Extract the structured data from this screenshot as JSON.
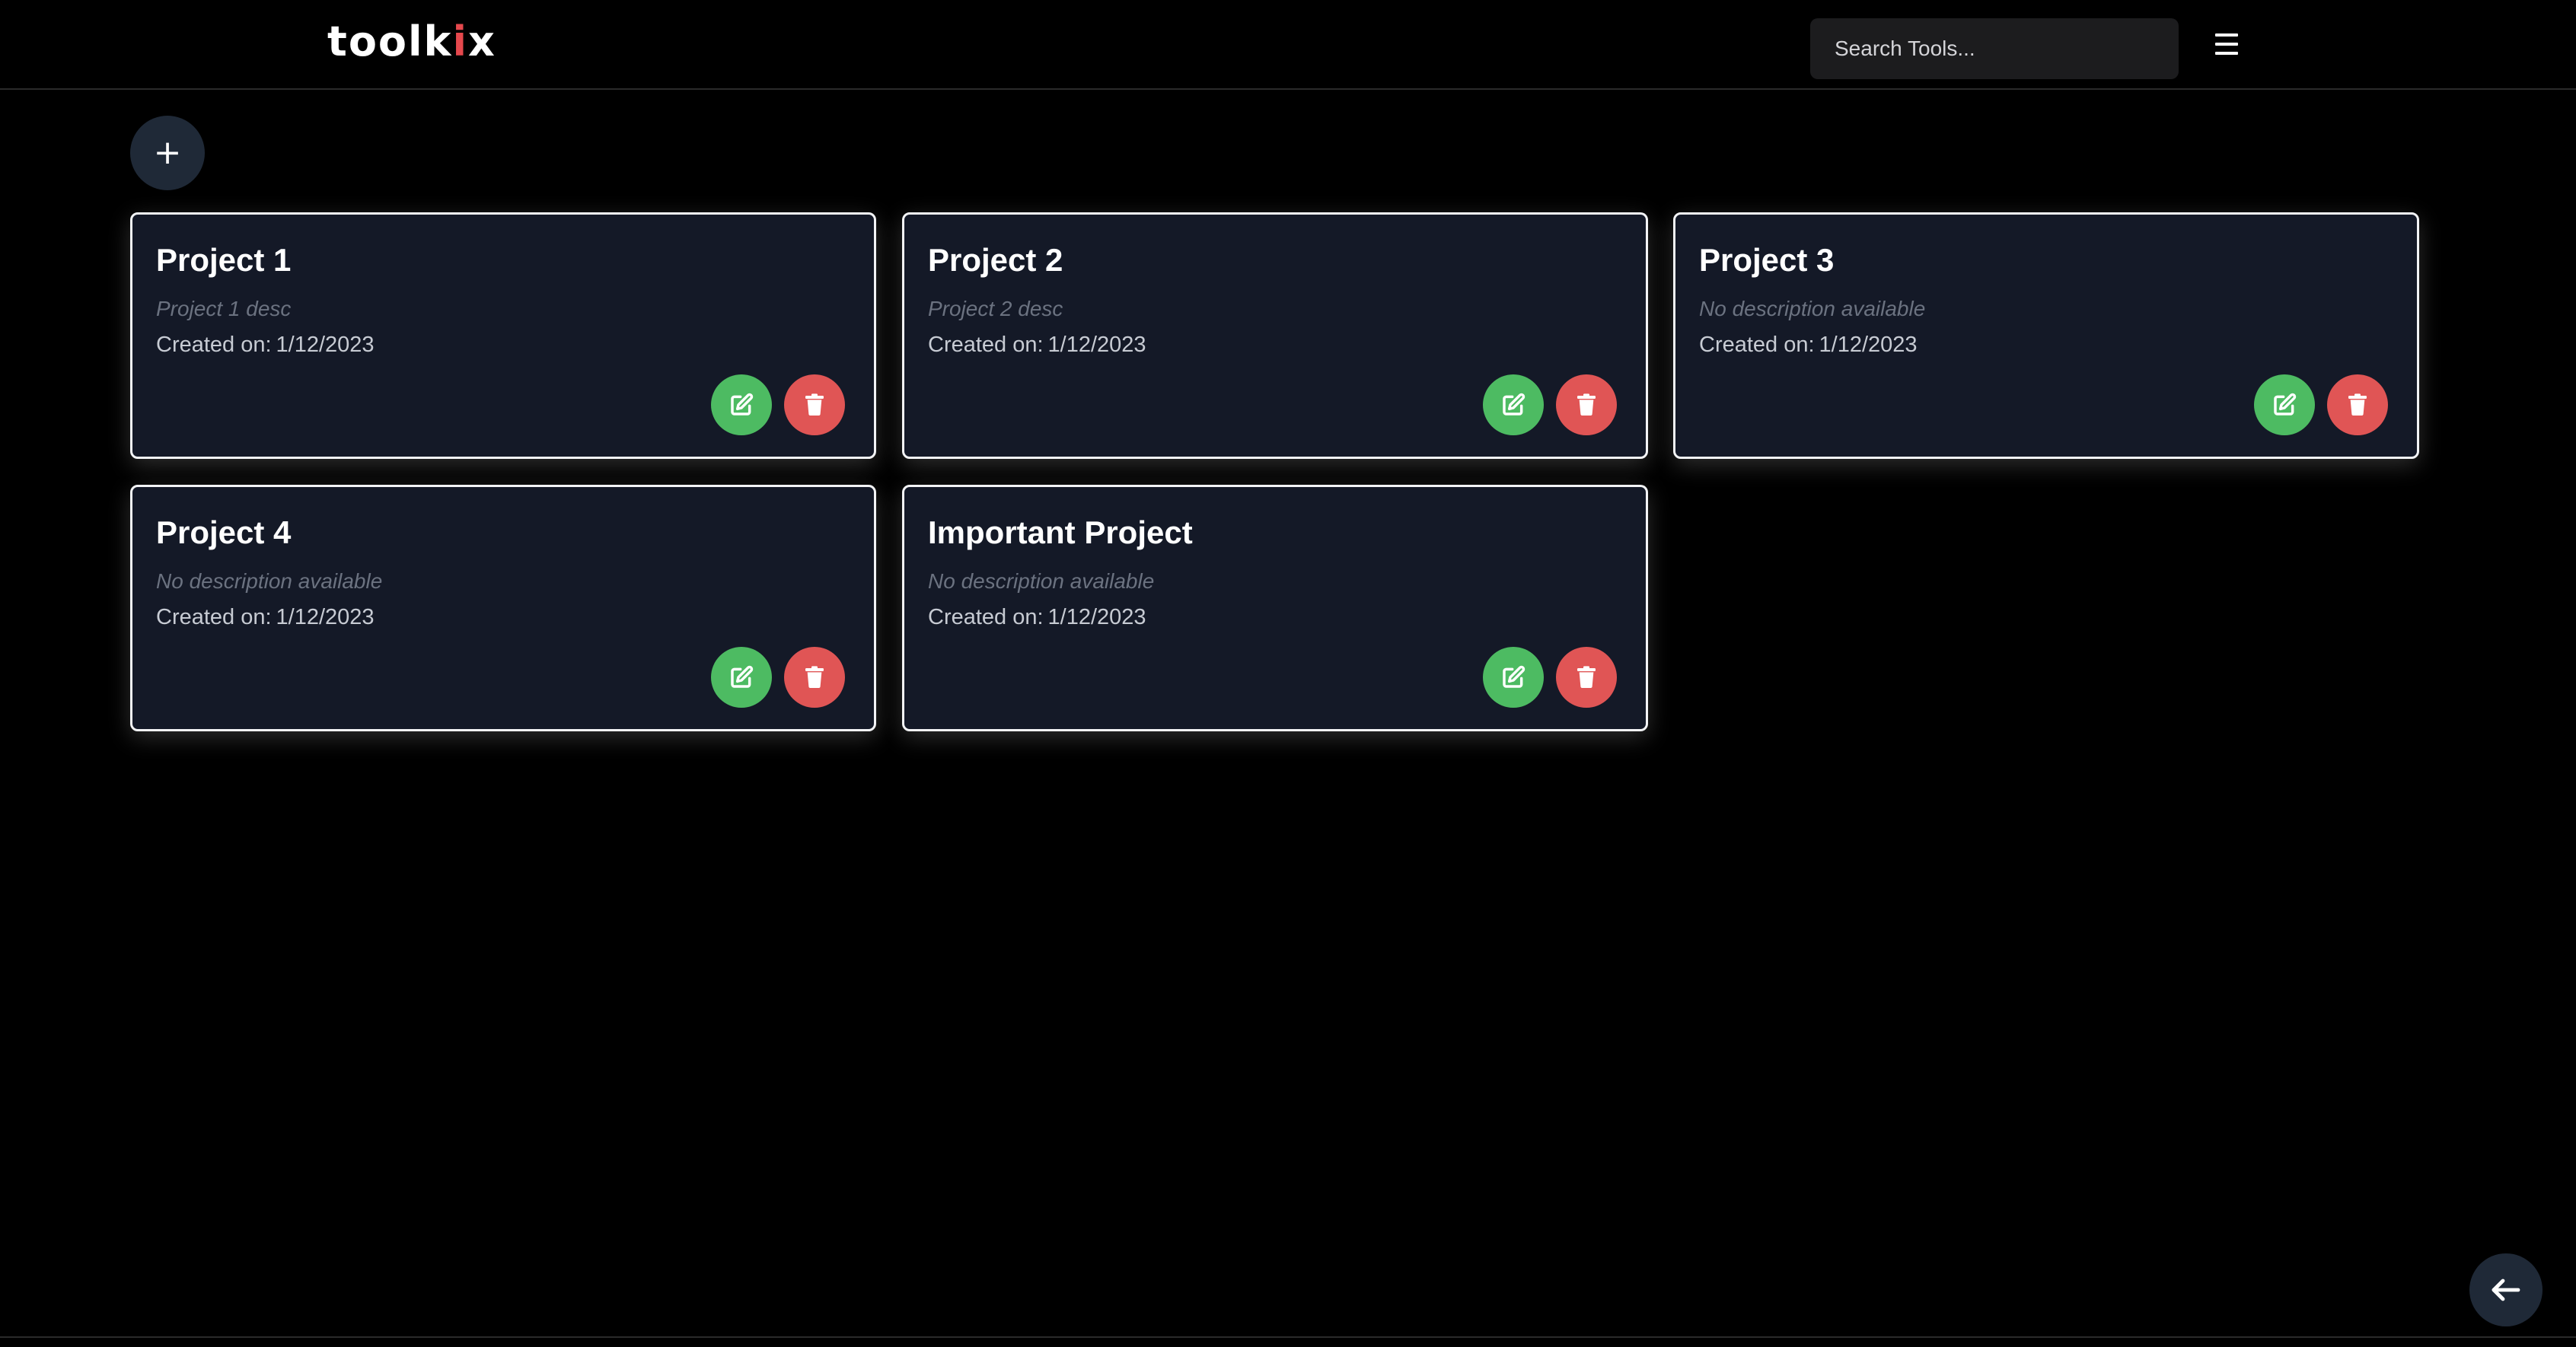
{
  "header": {
    "logo_prefix": "toolk",
    "logo_accent": "i",
    "logo_suffix": "x",
    "search_placeholder": "Search Tools...",
    "menu_icon": "hamburger-menu-icon"
  },
  "actions": {
    "add_label": "+",
    "back_icon": "arrow-left-icon"
  },
  "colors": {
    "background": "#000000",
    "card_background": "#141927",
    "edit_button": "#4dbb62",
    "delete_button": "#e05555",
    "logo_accent": "#e5484d"
  },
  "projects": [
    {
      "title": "Project 1",
      "description": "Project 1 desc",
      "created_label": "Created on:",
      "created_date": "1/12/2023"
    },
    {
      "title": "Project 2",
      "description": "Project 2 desc",
      "created_label": "Created on:",
      "created_date": "1/12/2023"
    },
    {
      "title": "Project 3",
      "description": "No description available",
      "created_label": "Created on:",
      "created_date": "1/12/2023"
    },
    {
      "title": "Project 4",
      "description": "No description available",
      "created_label": "Created on:",
      "created_date": "1/12/2023"
    },
    {
      "title": "Important Project",
      "description": "No description available",
      "created_label": "Created on:",
      "created_date": "1/12/2023"
    }
  ]
}
